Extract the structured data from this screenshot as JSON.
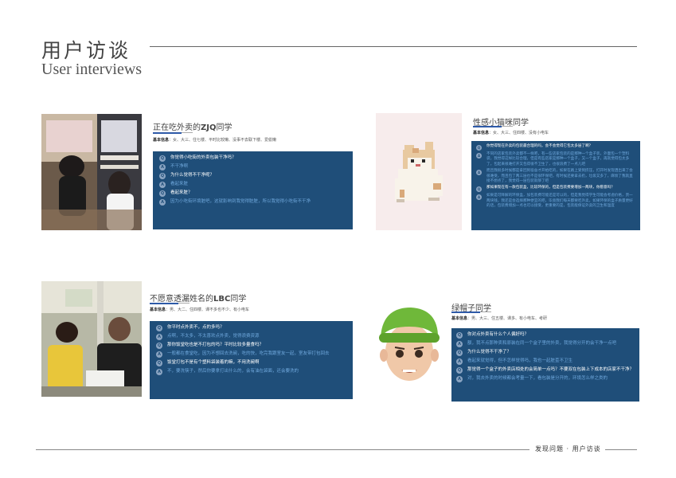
{
  "header": {
    "title_cn": "用户访谈",
    "title_en": "User interviews"
  },
  "cards": [
    {
      "title": "正在吃外卖的",
      "title_bold": "ZJQ",
      "title_suffix": "同学",
      "info_label": "基本信息",
      "info": "女、大三、住七楼、平时比较懒、没事不去联下楼、爱偷懒",
      "qa": [
        {
          "badge": "Q",
          "kind": "q",
          "text": "你觉得小吃街的外卖包装干净吗？"
        },
        {
          "badge": "A",
          "kind": "a",
          "text": "不干净啊"
        },
        {
          "badge": "Q",
          "kind": "q",
          "text": "为什么觉得不干净呢？"
        },
        {
          "badge": "A",
          "kind": "a",
          "text": "看起来脏"
        },
        {
          "badge": "Q",
          "kind": "q",
          "text": "看起来脏？"
        },
        {
          "badge": "A",
          "kind": "a",
          "text": "因为小吃街环境脏吧，这就影响到我觉得脏脏，所以我觉得小吃街不干净"
        }
      ]
    },
    {
      "title": "性感小猫咪同学",
      "info_label": "基本信息",
      "info": "女、大三、住四楼、没有小电车",
      "qa": [
        {
          "badge": "Q",
          "kind": "q",
          "text": "你觉得现在外卖的包装最合理的吗，会不会觉得它包太多层了啊？"
        },
        {
          "badge": "A",
          "kind": "a",
          "text": "不同的店家包装外卖都不一样吧，有一些店家包装的是那种一个盒子装，外面包一个塑料袋，我觉得这样比较合理，但是有些店家是那种一个盒子，又一个盒子，再就觉得包太多了，包起来很难打开又包得很不卫生了，也很浪费了一点儿吧"
        },
        {
          "badge": "A",
          "kind": "a",
          "text": "而且我很多时候都是拿回到宿舍才开始吃的，如果在路上受到挤压，打开时发现洒出来了会很难受，而且包了两三层也不是很环保吧，有时候还要拿去扔，垃圾又多了，麻烦了我就直接不想点了，我觉得一层包装就够了吧"
        },
        {
          "badge": "Q",
          "kind": "q",
          "text": "那如果现在有一款包装盒，比较环保的，但是包装费要增加一两块，你愿意吗？"
        },
        {
          "badge": "A",
          "kind": "a",
          "text": "如果是可降解的环保盒，加包装费可能还是可以的，但是我觉得学生可能会考虑价格，贵一两块钱，我还是会选择那种便宜的吧，毕竟我们每天都要吃外卖，如果环保的盒子质量更好的话，包装费增加一点也可以接受，更重要的是，包装能保证外卖的卫生和温度"
        }
      ]
    },
    {
      "title": "不愿意透漏姓名的",
      "title_bold": "LBC",
      "title_suffix": "同学",
      "info_label": "基本信息",
      "info": "男、大二、住四楼、课不多也不少、有小电车",
      "qa": [
        {
          "badge": "Q",
          "kind": "q",
          "text": "你平时点外卖不，点的多吗？"
        },
        {
          "badge": "A",
          "kind": "a",
          "text": "点啊，不太多，不太喜欢点外卖，觉得浪费资源"
        },
        {
          "badge": "Q",
          "kind": "q",
          "text": "那你饭堂吃也是不打包的吗？平时比较多量食吗？"
        },
        {
          "badge": "A",
          "kind": "a",
          "text": "一般都在食堂吃，因为不想回去洗碗，吃的快，吃完我跟室友一起，室友带打包回去"
        },
        {
          "badge": "Q",
          "kind": "q",
          "text": "饭堂打包不是有个塑料袋装着的嘛，不用洗碗啊"
        },
        {
          "badge": "A",
          "kind": "a",
          "text": "不，要洗筷子，然后你要拿打出什么的，会有油在袋面，还会要洗的"
        }
      ]
    },
    {
      "title": "绿帽子同学",
      "info_label": "基本信息",
      "info": "男、大三、住五楼、课多、有小电车、考研",
      "qa": [
        {
          "badge": "Q",
          "kind": "q",
          "text": "你对点外卖有什么个人偏好吗？"
        },
        {
          "badge": "A",
          "kind": "a",
          "text": "额，我不点那种卖和原装在同一个盒子里的外卖，我觉得分开的会干净一点吧"
        },
        {
          "badge": "Q",
          "kind": "q",
          "text": "为什么觉得不干净了？"
        },
        {
          "badge": "A",
          "kind": "a",
          "text": "看起来就觉得，但不怎样觉得吗，我也一起脏歪不卫生"
        },
        {
          "badge": "Q",
          "kind": "q",
          "text": "那觉得一个盒子的外卖店相处的会简单一点吗？不要双在包装上下成本的店家不干净？"
        },
        {
          "badge": "A",
          "kind": "a",
          "text": "对，我去外卖的时候都会考量一下，看包装是分开的，环境怎么样之类的"
        }
      ]
    }
  ],
  "footer": {
    "text": "发现问题 · 用户访谈"
  }
}
